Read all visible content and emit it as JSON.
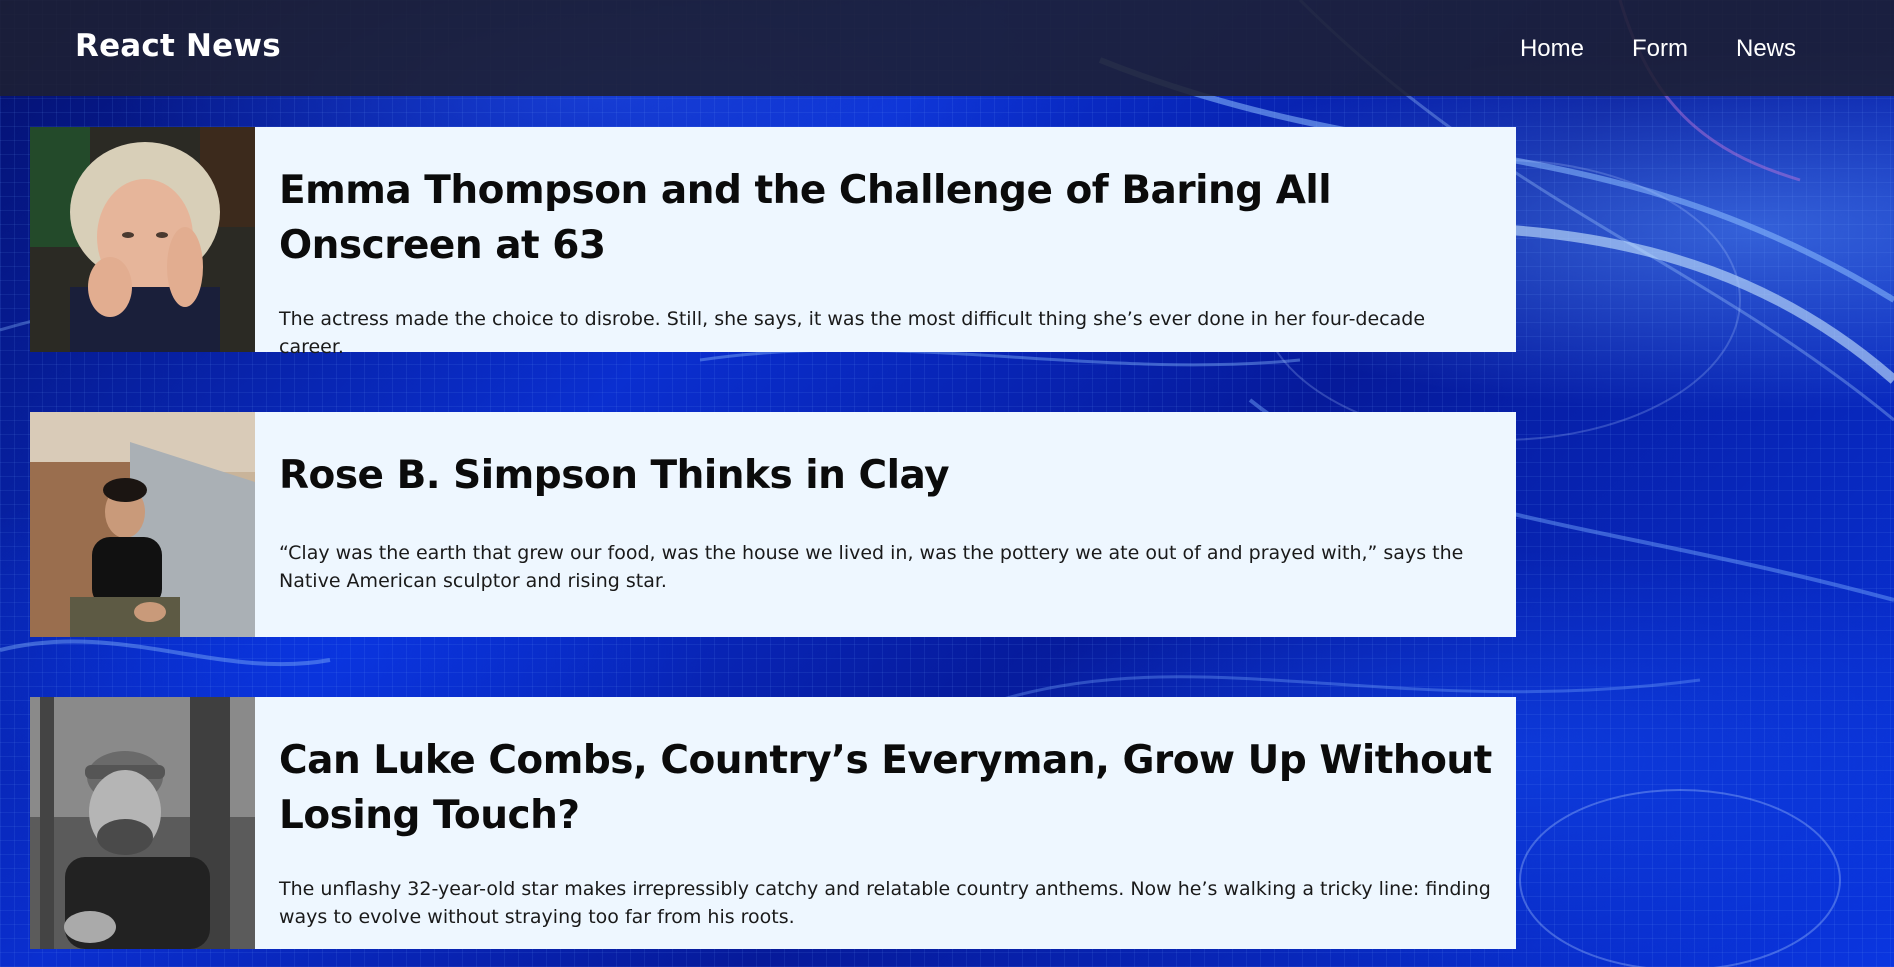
{
  "navbar": {
    "brand": "React News",
    "links": [
      {
        "label": "Home"
      },
      {
        "label": "Form"
      },
      {
        "label": "News"
      }
    ]
  },
  "articles": [
    {
      "title": "Emma Thompson and the Challenge of Baring All Onscreen at 63",
      "summary": "The actress made the choice to disrobe. Still, she says, it was the most difficult thing she’s ever done in her four-decade career.",
      "image": "portrait-woman-blonde-hair"
    },
    {
      "title": "Rose B. Simpson Thinks in Clay",
      "summary": "“Clay was the earth that grew our food, was the house we lived in, was the pottery we ate out of and prayed with,” says the Native American sculptor and rising star.",
      "image": "portrait-woman-seated-wall"
    },
    {
      "title": "Can Luke Combs, Country’s Everyman, Grow Up Without Losing Touch?",
      "summary": "The unflashy 32-year-old star makes irrepressibly catchy and relatable country anthems. Now he’s walking a tricky line: finding ways to evolve without straying too far from his roots.",
      "image": "portrait-man-cap-bw"
    }
  ]
}
